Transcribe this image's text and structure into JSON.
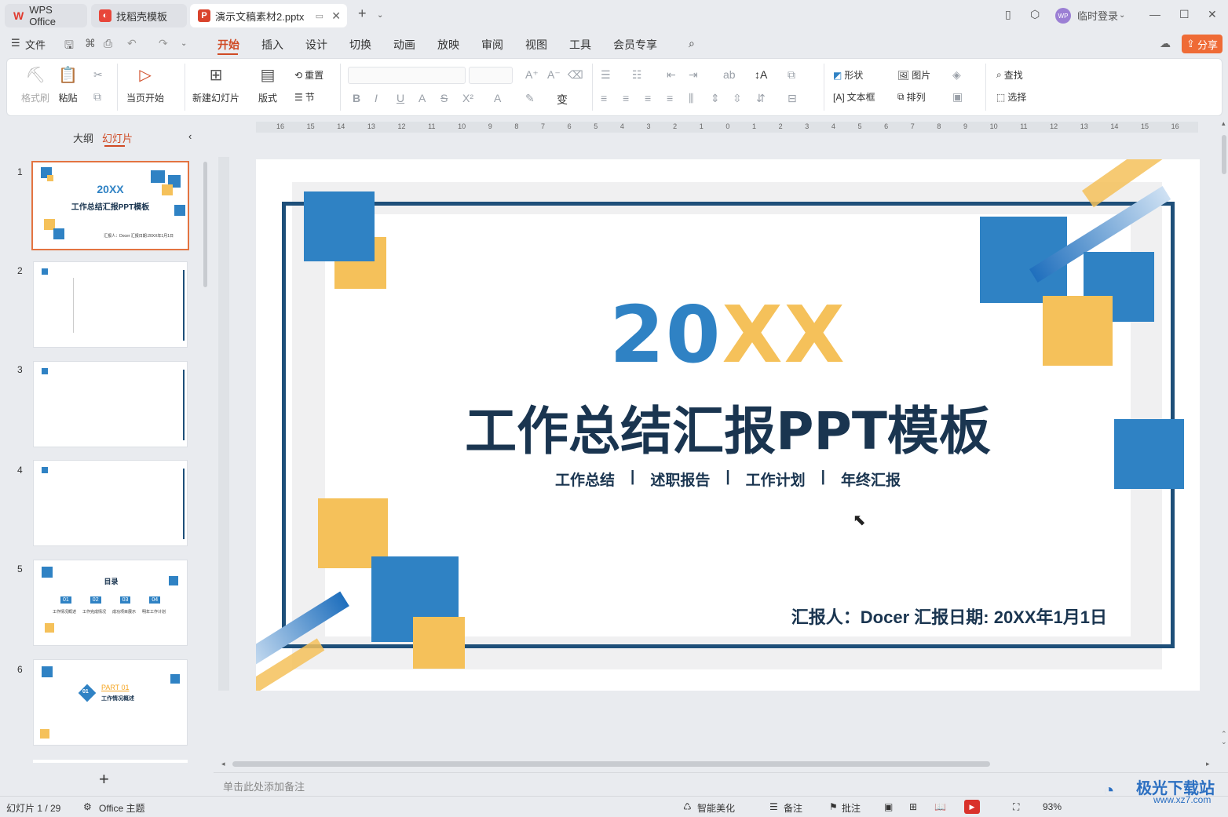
{
  "titlebar": {
    "tabs": [
      "WPS Office",
      "找稻壳模板",
      "演示文稿素材2.pptx"
    ],
    "login": "临时登录",
    "avatar": "WP"
  },
  "menubar": {
    "file": "文件",
    "items": [
      "开始",
      "插入",
      "设计",
      "切换",
      "动画",
      "放映",
      "审阅",
      "视图",
      "工具",
      "会员专享"
    ],
    "share": "分享"
  },
  "ribbon": {
    "format_painter": "格式刷",
    "paste": "粘贴",
    "start_from_current": "当页开始",
    "new_slide": "新建幻灯片",
    "layout": "版式",
    "reset": "重置",
    "section": "节",
    "shape": "形状",
    "picture": "图片",
    "find": "查找",
    "textbox": "文本框",
    "arrange": "排列",
    "select": "选择"
  },
  "leftpanel": {
    "tabs": [
      "大纲",
      "幻灯片"
    ],
    "slides": [
      "1",
      "2",
      "3",
      "4",
      "5",
      "6"
    ],
    "thumb1": {
      "year": "20XX",
      "title": "工作总结汇报PPT模板",
      "reporter": "汇报人：Docer 汇报日期:20XX年1月1日"
    },
    "thumb5": {
      "title": "目录",
      "items": [
        "01",
        "02",
        "03",
        "04"
      ],
      "labels": [
        "工作情况概述",
        "工作完成情况",
        "成功项目展示",
        "明年工作计划"
      ]
    },
    "thumb6": {
      "num": "01",
      "part": "PART 01",
      "subtitle": "工作情况概述"
    },
    "add": "+"
  },
  "ruler_marks": [
    "16",
    "15",
    "14",
    "13",
    "12",
    "11",
    "10",
    "9",
    "8",
    "7",
    "6",
    "5",
    "4",
    "3",
    "2",
    "1",
    "0",
    "1",
    "2",
    "3",
    "4",
    "5",
    "6",
    "7",
    "8",
    "9",
    "10",
    "11",
    "12",
    "13",
    "14",
    "15",
    "16"
  ],
  "slide": {
    "year_a": "20",
    "year_b": "XX",
    "title": "工作总结汇报PPT模板",
    "subs": [
      "工作总结",
      "述职报告",
      "工作计划",
      "年终汇报"
    ],
    "separator": "|",
    "reporter": "汇报人：Docer  汇报日期: 20XX年1月1日",
    "colors": {
      "blue": "#2f82c4",
      "yellow": "#f5c15a",
      "navy": "#1e4f79"
    }
  },
  "notes": {
    "placeholder": "单击此处添加备注"
  },
  "statusbar": {
    "slide_count": "幻灯片 1 / 29",
    "theme": "Office 主题",
    "beautify": "智能美化",
    "notes": "备注",
    "comments": "批注",
    "zoom": "93%"
  },
  "watermark": {
    "name": "极光下载站",
    "url": "www.xz7.com"
  }
}
